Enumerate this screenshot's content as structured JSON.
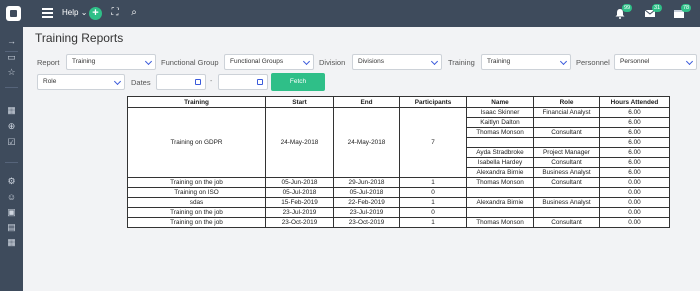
{
  "topbar": {
    "help_label": "Help",
    "badges": {
      "notifications": "99",
      "messages": "31",
      "tasks": "78"
    }
  },
  "page": {
    "title": "Training Reports"
  },
  "filters": {
    "report_label": "Report",
    "report_value": "Training",
    "functional_group_label": "Functional Group",
    "functional_group_value": "Functional Groups",
    "division_label": "Division",
    "division_value": "Divisions",
    "training_label": "Training",
    "training_value": "Training",
    "personnel_label": "Personnel",
    "personnel_value": "Personnel",
    "role_value": "Role",
    "dates_label": "Dates",
    "dash": "-",
    "fetch_label": "Fetch"
  },
  "table": {
    "headers": [
      "Training",
      "Start",
      "End",
      "Participants",
      "Name",
      "Role",
      "Hours Attended"
    ],
    "group": {
      "training": "Training on GDPR",
      "start": "24-May-2018",
      "end": "24-May-2018",
      "participants": "7",
      "rows": [
        {
          "name": "Isaac Skinner",
          "role": "Financial Analyst",
          "hours": "6.00"
        },
        {
          "name": "Kaitlyn Dalton",
          "role": "",
          "hours": "6.00"
        },
        {
          "name": "Thomas Monson",
          "role": "Consultant",
          "hours": "6.00"
        },
        {
          "name": "",
          "role": "",
          "hours": "6.00"
        },
        {
          "name": "Ayda Stradbroke",
          "role": "Project Manager",
          "hours": "6.00"
        },
        {
          "name": "Isabella Hardey",
          "role": "Consultant",
          "hours": "6.00"
        },
        {
          "name": "Alexandra Birnie",
          "role": "Business Analyst",
          "hours": "6.00"
        }
      ]
    },
    "rows": [
      {
        "training": "Training on the job",
        "start": "05-Jun-2018",
        "end": "29-Jun-2018",
        "participants": "1",
        "name": "Thomas Monson",
        "role": "Consultant",
        "hours": "0.00"
      },
      {
        "training": "Training on ISO",
        "start": "05-Jul-2018",
        "end": "05-Jul-2018",
        "participants": "0",
        "name": "",
        "role": "",
        "hours": "0.00"
      },
      {
        "training": "sdas",
        "start": "15-Feb-2019",
        "end": "22-Feb-2019",
        "participants": "1",
        "name": "Alexandra Birnie",
        "role": "Business Analyst",
        "hours": "0.00"
      },
      {
        "training": "Training on the job",
        "start": "23-Jul-2019",
        "end": "23-Jul-2019",
        "participants": "0",
        "name": "",
        "role": "",
        "hours": "0.00"
      },
      {
        "training": "Training on the job",
        "start": "23-Oct-2019",
        "end": "23-Oct-2019",
        "participants": "1",
        "name": "Thomas Monson",
        "role": "Consultant",
        "hours": "0.00"
      }
    ]
  }
}
